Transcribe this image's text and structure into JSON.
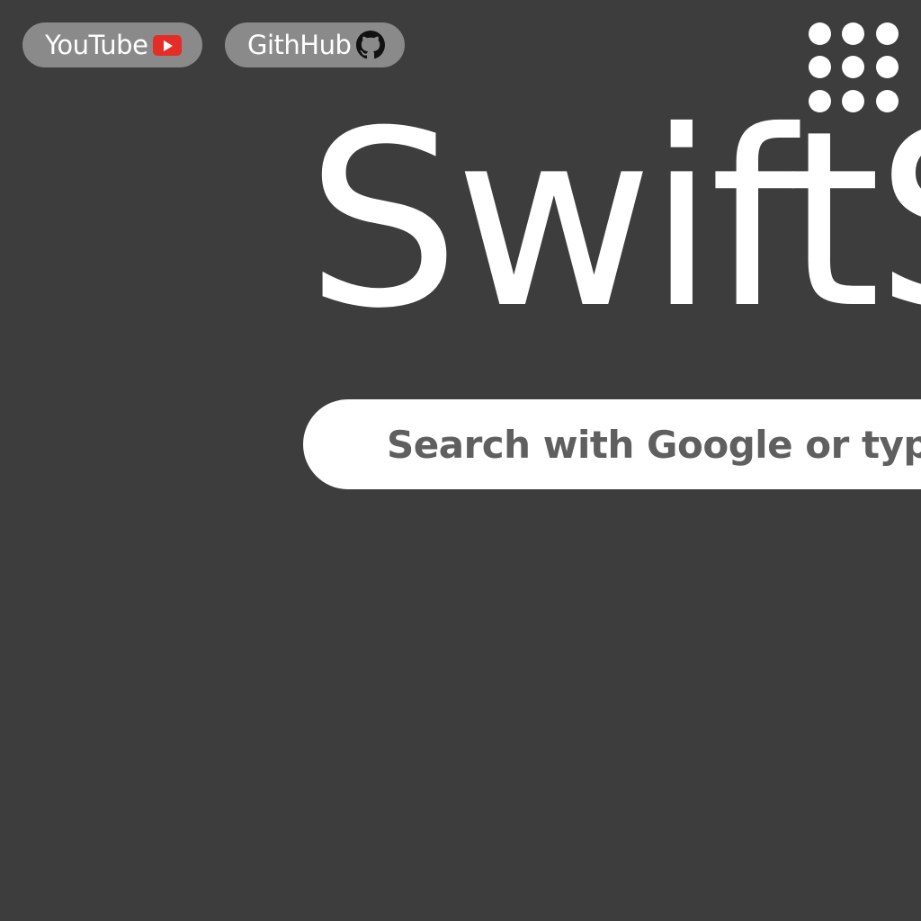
{
  "links": [
    {
      "label": "YouTube",
      "icon": "youtube-icon",
      "icon_color": "#e52d27"
    },
    {
      "label": "GithHub",
      "icon": "github-icon"
    }
  ],
  "apps_menu": {
    "icon": "apps-grid-icon"
  },
  "logo": {
    "text": "SwiftS"
  },
  "search": {
    "placeholder": "Search with Google or type"
  },
  "colors": {
    "background": "#3d3d3d",
    "pill": "#8a8a8a",
    "text": "#ffffff",
    "placeholder": "#5f5f5f"
  }
}
